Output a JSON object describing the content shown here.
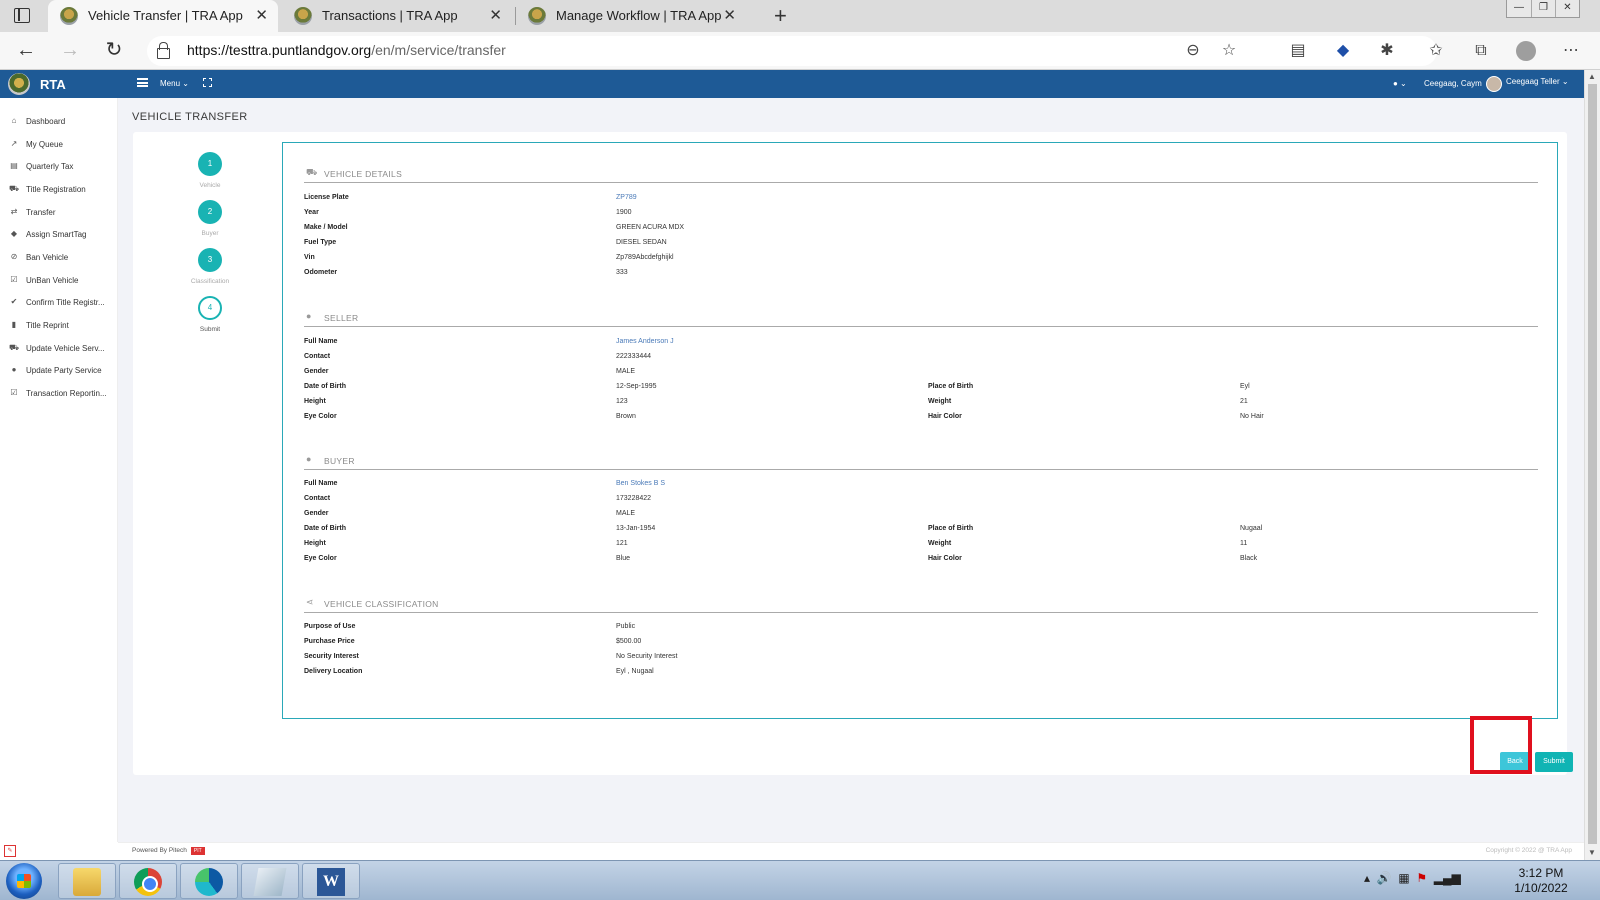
{
  "browser": {
    "tabs": [
      {
        "title": "Vehicle Transfer | TRA App",
        "active": true
      },
      {
        "title": "Transactions | TRA App",
        "active": false
      },
      {
        "title": "Manage Workflow | TRA App",
        "active": false
      }
    ],
    "url_host": "https://testtra.puntlandgov.org",
    "url_path": "/en/m/service/transfer"
  },
  "app": {
    "name": "RTA",
    "menu_label": "Menu ⌄",
    "user_name": "Ceegaag, Caym",
    "teller_label": "Ceegaag Teller ⌄"
  },
  "sidebar": {
    "items": [
      {
        "label": "Dashboard",
        "icon": "home-icon"
      },
      {
        "label": "My Queue",
        "icon": "trend-icon"
      },
      {
        "label": "Quarterly Tax",
        "icon": "table-icon"
      },
      {
        "label": "Title Registration",
        "icon": "car-icon"
      },
      {
        "label": "Transfer",
        "icon": "transfer-icon"
      },
      {
        "label": "Assign SmartTag",
        "icon": "tag-icon"
      },
      {
        "label": "Ban Vehicle",
        "icon": "ban-icon"
      },
      {
        "label": "UnBan Vehicle",
        "icon": "check-square-icon"
      },
      {
        "label": "Confirm Title Registr...",
        "icon": "check-icon"
      },
      {
        "label": "Title Reprint",
        "icon": "file-icon"
      },
      {
        "label": "Update Vehicle Serv...",
        "icon": "car-icon"
      },
      {
        "label": "Update Party Service",
        "icon": "user-icon"
      },
      {
        "label": "Transaction Reportin...",
        "icon": "check-square-icon"
      }
    ]
  },
  "page": {
    "title": "VEHICLE TRANSFER",
    "steps": [
      {
        "num": "1",
        "label": "Vehicle"
      },
      {
        "num": "2",
        "label": "Buyer"
      },
      {
        "num": "3",
        "label": "Classification"
      },
      {
        "num": "4",
        "label": "Submit"
      }
    ],
    "vehicle": {
      "header": "VEHICLE DETAILS",
      "rows": [
        {
          "k": "License Plate",
          "v": "ZP789"
        },
        {
          "k": "Year",
          "v": "1900"
        },
        {
          "k": "Make / Model",
          "v": "GREEN ACURA MDX"
        },
        {
          "k": "Fuel Type",
          "v": "DIESEL SEDAN"
        },
        {
          "k": "Vin",
          "v": "Zp789Abcdefghijkl"
        },
        {
          "k": "Odometer",
          "v": "333"
        }
      ]
    },
    "seller": {
      "header": "SELLER",
      "full_name_k": "Full Name",
      "full_name": "James Anderson J",
      "contact_k": "Contact",
      "contact": "222333444",
      "gender_k": "Gender",
      "gender": "MALE",
      "dob_k": "Date of Birth",
      "dob": "12-Sep-1995",
      "pob_k": "Place of Birth",
      "pob": "Eyl",
      "height_k": "Height",
      "height": "123",
      "weight_k": "Weight",
      "weight": "21",
      "eye_k": "Eye Color",
      "eye": "Brown",
      "hair_k": "Hair Color",
      "hair": "No Hair"
    },
    "buyer": {
      "header": "BUYER",
      "full_name_k": "Full Name",
      "full_name": "Ben Stokes B S",
      "contact_k": "Contact",
      "contact": "173228422",
      "gender_k": "Gender",
      "gender": "MALE",
      "dob_k": "Date of Birth",
      "dob": "13-Jan-1954",
      "pob_k": "Place of Birth",
      "pob": "Nugaal",
      "height_k": "Height",
      "height": "121",
      "weight_k": "Weight",
      "weight": "11",
      "eye_k": "Eye Color",
      "eye": "Blue",
      "hair_k": "Hair Color",
      "hair": "Black"
    },
    "classification": {
      "header": "VEHICLE CLASSIFICATION",
      "rows": [
        {
          "k": "Purpose of Use",
          "v": "Public"
        },
        {
          "k": "Purchase Price",
          "v": "$500.00"
        },
        {
          "k": "Security Interest",
          "v": "No Security Interest"
        },
        {
          "k": "Delivery Location",
          "v": "Eyl , Nugaal"
        }
      ]
    },
    "back_label": "Back",
    "submit_label": "Submit"
  },
  "footer": {
    "powered": "Powered By Pitech",
    "powered_badge": "PIT",
    "copyright": "Copyright © 2022 @ TRA App"
  },
  "taskbar": {
    "time": "3:12 PM",
    "date": "1/10/2022"
  },
  "colors": {
    "header_blue": "#1e5a96",
    "teal": "#19b3b3",
    "highlight_red": "#e0101e"
  }
}
